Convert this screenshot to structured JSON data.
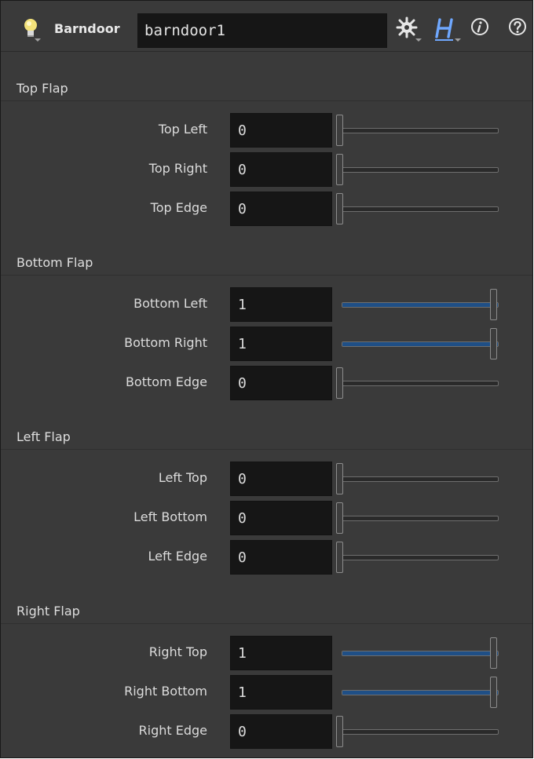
{
  "header": {
    "op_type": "Barndoor",
    "node_name": "barndoor1",
    "icons": [
      "bulb-icon",
      "gear-icon",
      "houdini-h-icon",
      "info-icon",
      "help-icon"
    ]
  },
  "colors": {
    "panel_bg": "#3a3a3a",
    "field_bg": "#161616",
    "slider_fill": "#1f4f86"
  },
  "sections": [
    {
      "title": "Top Flap",
      "params": [
        {
          "label": "Top Left",
          "value": "0",
          "fraction": 0
        },
        {
          "label": "Top Right",
          "value": "0",
          "fraction": 0
        },
        {
          "label": "Top Edge",
          "value": "0",
          "fraction": 0
        }
      ]
    },
    {
      "title": "Bottom Flap",
      "params": [
        {
          "label": "Bottom Left",
          "value": "1",
          "fraction": 1
        },
        {
          "label": "Bottom Right",
          "value": "1",
          "fraction": 1
        },
        {
          "label": "Bottom Edge",
          "value": "0",
          "fraction": 0
        }
      ]
    },
    {
      "title": "Left Flap",
      "params": [
        {
          "label": "Left Top",
          "value": "0",
          "fraction": 0
        },
        {
          "label": "Left Bottom",
          "value": "0",
          "fraction": 0
        },
        {
          "label": "Left Edge",
          "value": "0",
          "fraction": 0
        }
      ]
    },
    {
      "title": "Right Flap",
      "params": [
        {
          "label": "Right Top",
          "value": "1",
          "fraction": 1
        },
        {
          "label": "Right Bottom",
          "value": "1",
          "fraction": 1
        },
        {
          "label": "Right Edge",
          "value": "0",
          "fraction": 0
        }
      ]
    }
  ]
}
